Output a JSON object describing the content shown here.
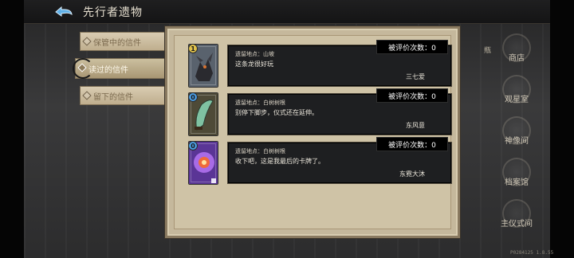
{
  "header": {
    "title": "先行者遗物"
  },
  "tabs": [
    {
      "label": "保管中的信件",
      "active": false
    },
    {
      "label": "读过的信件",
      "active": true
    },
    {
      "label": "留下的信件",
      "active": false
    }
  ],
  "letters": [
    {
      "badge": "1",
      "badge_color": "#e0c24c",
      "card_icon": "dragon-card-icon",
      "card_colors": [
        "#6f7884",
        "#3e4650"
      ],
      "location": "遗留地点：山坡",
      "text": "这条龙很好玩",
      "author": "三七爱",
      "rating_count": "被评价次数：0"
    },
    {
      "badge": "0",
      "badge_color": "#4a9be0",
      "card_icon": "sword-card-icon",
      "card_colors": [
        "#6f6a52",
        "#3d3b2c"
      ],
      "location": "遗留地点：白树树根",
      "text": "别停下脚步，仪式还在延伸。",
      "author": "东风意",
      "rating_count": "被评价次数：0"
    },
    {
      "badge": "0",
      "badge_color": "#4a9be0",
      "card_icon": "purple-orb-card-icon",
      "card_colors": [
        "#9c5ad8",
        "#4c2a8c"
      ],
      "location": "遗留地点：白树树根",
      "text": "收下吧，这是我最后的卡牌了。",
      "author": "东霓大沐",
      "rating_count": "被评价次数：0"
    }
  ],
  "rightnav": {
    "side_label": "瓶",
    "items": [
      {
        "label": "商店",
        "icon": "shop-emblem-icon"
      },
      {
        "label": "观星室",
        "icon": "observatory-emblem-icon"
      },
      {
        "label": "神像间",
        "icon": "statue-emblem-icon"
      },
      {
        "label": "档案馆",
        "icon": "archive-emblem-icon"
      },
      {
        "label": "主仪式间",
        "icon": "ritual-emblem-icon"
      }
    ]
  },
  "footer": {
    "version": "P0284125 1.8.55"
  }
}
